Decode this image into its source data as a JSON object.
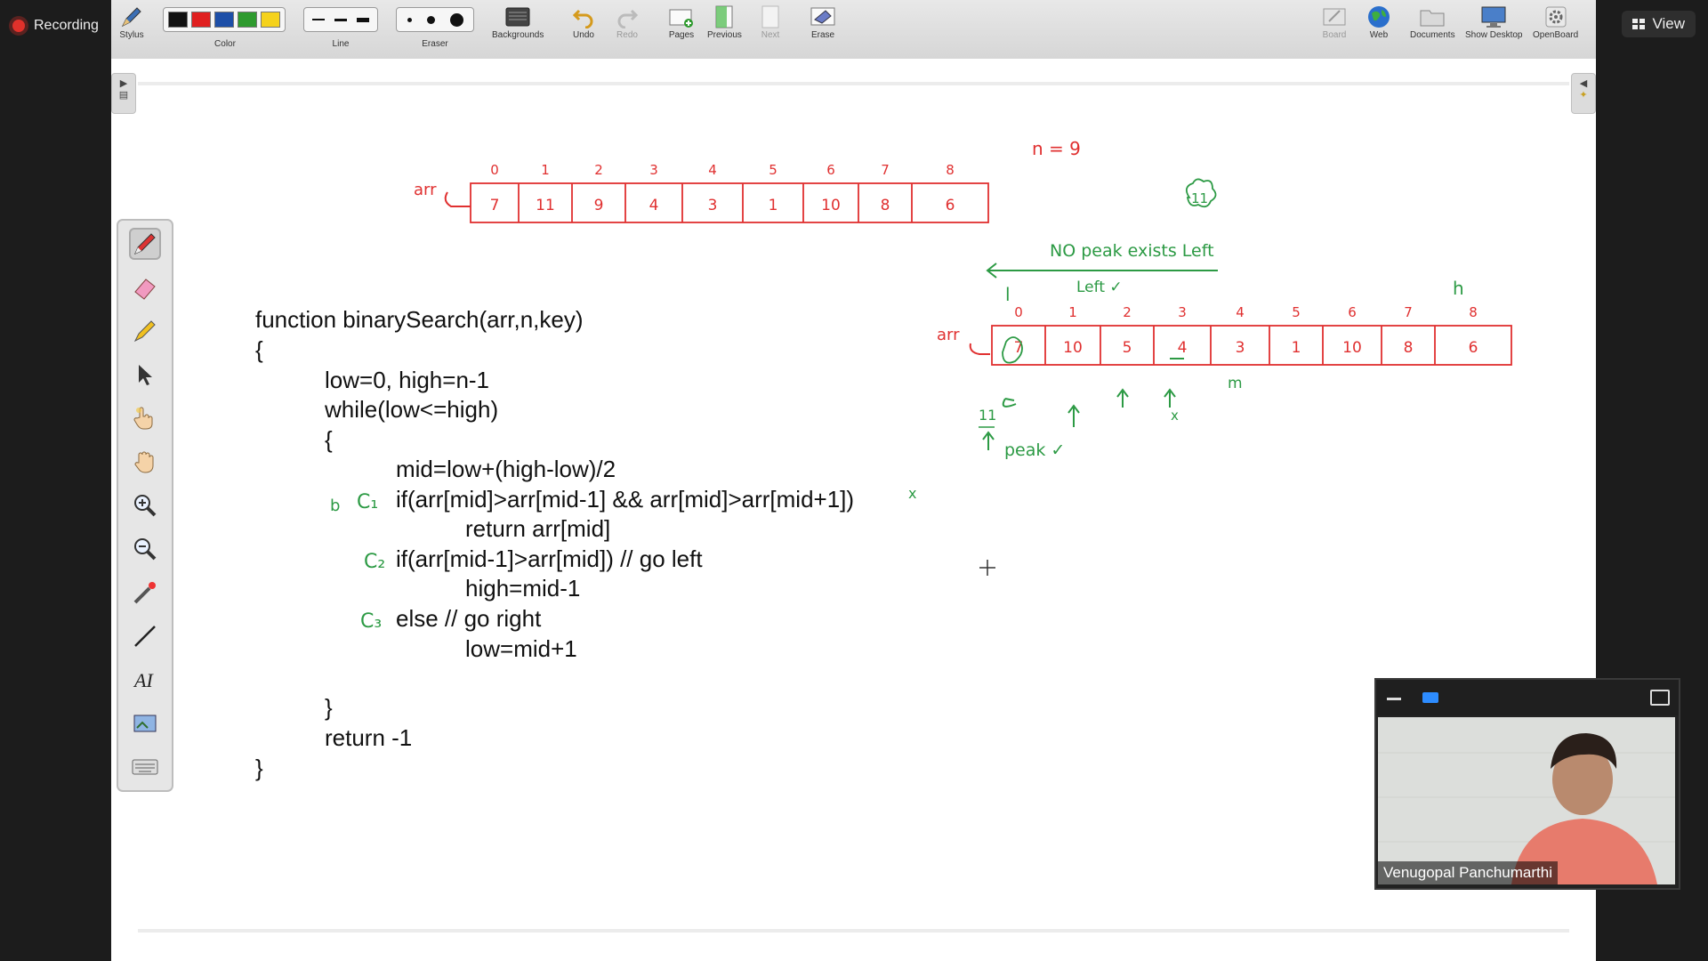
{
  "zoom": {
    "recording_label": "Recording",
    "view_label": "View"
  },
  "toolbar": {
    "stylus": "Stylus",
    "color": "Color",
    "line": "Line",
    "eraser": "Eraser",
    "backgrounds": "Backgrounds",
    "undo": "Undo",
    "redo": "Redo",
    "pages": "Pages",
    "previous": "Previous",
    "next": "Next",
    "erase": "Erase",
    "board": "Board",
    "web": "Web",
    "documents": "Documents",
    "show_desktop": "Show Desktop",
    "openboard": "OpenBoard",
    "colors": [
      "#111111",
      "#e02020",
      "#1d4fa8",
      "#2e9a2e",
      "#f5d21c"
    ]
  },
  "code_lines": [
    "function binarySearch(arr,n,key)",
    "{",
    "low=0, high=n-1",
    "while(low<=high)",
    "{",
    "mid=low+(high-low)/2",
    "if(arr[mid]>arr[mid-1] && arr[mid]>arr[mid+1])",
    "return arr[mid]",
    "if(arr[mid-1]>arr[mid]) // go left",
    "high=mid-1",
    "else // go right",
    "low=mid+1",
    "}",
    "return -1",
    "}"
  ],
  "annotations": {
    "c1": "C₁",
    "c2": "C₂",
    "c3": "C₃",
    "b": "b",
    "x_mark": "x",
    "n_eq": "n = 9",
    "no_peak": "NO peak exists Left",
    "left": "Left ✓",
    "l": "l",
    "h": "h",
    "m": "m",
    "x": "x",
    "eleven": "11",
    "peak": "peak ✓",
    "arr": "arr"
  },
  "array_top": {
    "indices": [
      "0",
      "1",
      "2",
      "3",
      "4",
      "5",
      "6",
      "7",
      "8"
    ],
    "values": [
      "7",
      "11",
      "9",
      "4",
      "3",
      "1",
      "10",
      "8",
      "6"
    ]
  },
  "array_right": {
    "indices": [
      "0",
      "1",
      "2",
      "3",
      "4",
      "5",
      "6",
      "7",
      "8"
    ],
    "values": [
      "7",
      "10",
      "5",
      "4",
      "3",
      "1",
      "10",
      "8",
      "6"
    ]
  },
  "participant": {
    "name": "Venugopal Panchumarthi"
  }
}
